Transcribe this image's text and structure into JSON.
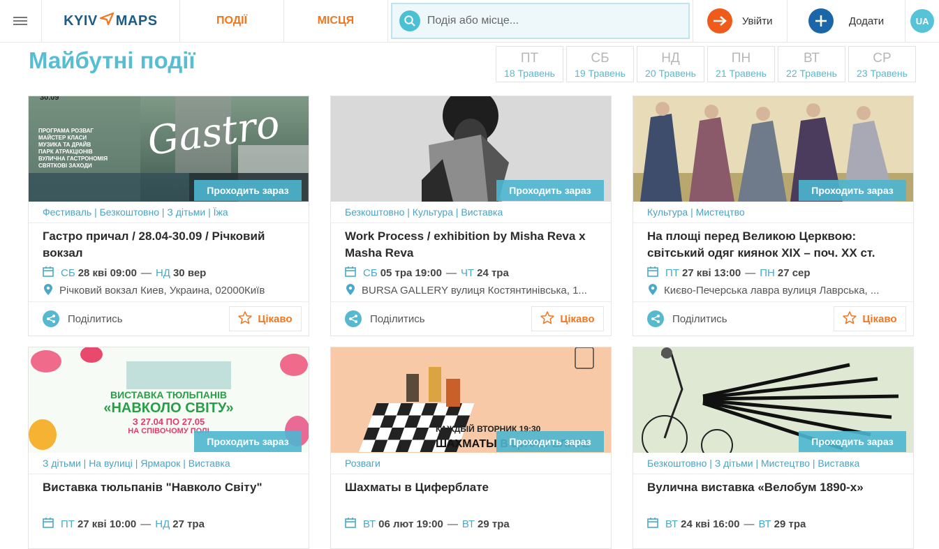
{
  "header": {
    "logo_left": "KYIV",
    "logo_right": "MAPS",
    "nav_events": "ПОДІЇ",
    "nav_places": "МІСЦЯ",
    "search_placeholder": "Подія або місце...",
    "login_label": "Увійти",
    "add_label": "Додати",
    "lang": "UA"
  },
  "page_title": "Майбутні події",
  "days": [
    {
      "name": "ПТ",
      "date": "18 Травень"
    },
    {
      "name": "СБ",
      "date": "19 Травень"
    },
    {
      "name": "НД",
      "date": "20 Травень"
    },
    {
      "name": "ПН",
      "date": "21 Травень"
    },
    {
      "name": "ВТ",
      "date": "22 Травень"
    },
    {
      "name": "СР",
      "date": "23 Травень"
    }
  ],
  "badge_label": "Проходить зараз",
  "share_label": "Поділитись",
  "fav_label": "Цікаво",
  "cards": [
    {
      "categories": "Фестиваль | Безкоштовно | З дітьми | Їжа",
      "title": "Гастро причал / 28.04-30.09 / Річковий вокзал",
      "start_wd": "СБ",
      "start": "28 кві 09:00",
      "end_wd": "НД",
      "end": "30 вер",
      "place": "Річковий вокзал Киев, Украина, 02000Київ",
      "image_text": [
        "ПРОГРАМА РОЗВАГ",
        "МАЙСТЕР КЛАСИ",
        "МУЗИКА ТА ДРАЙВ",
        "ПАРК АТРАКЦІОНІВ",
        "ВУЛИЧНА ГАСТРОНОМІЯ",
        "СВЯТКОВІ ЗАХОДИ"
      ],
      "image_script": "Gastro",
      "image_date": "30.09"
    },
    {
      "categories": "Безкоштовно | Культура | Виставка",
      "title": "Work Process / exhibition by Misha Reva x Masha Reva",
      "start_wd": "СБ",
      "start": "05 тра 19:00",
      "end_wd": "ЧТ",
      "end": "24 тра",
      "place": "BURSA GALLERY вулиця Костянтинівська, 1..."
    },
    {
      "categories": "Культура | Мистецтво",
      "title": "На площі перед Великою Церквою: світський одяг киянок XIX – поч. XX ст.",
      "start_wd": "ПТ",
      "start": "27 кві 13:00",
      "end_wd": "ПН",
      "end": "27 сер",
      "place": "Києво-Печерська лавра вулиця Лаврська, ..."
    },
    {
      "categories": "З дітьми | На вулиці | Ярмарок | Виставка",
      "title": "Виставка тюльпанів \"Навколо Світу\"",
      "start_wd": "ПТ",
      "start": "27 кві 10:00",
      "end_wd": "НД",
      "end": "27 тра",
      "image_text": [
        "ВИСТАВКА ТЮЛЬПАНІВ",
        "«НАВКОЛО СВІТУ»",
        "З 27.04 ПО 27.05",
        "НА СПІВОЧОМУ ПОЛІ"
      ]
    },
    {
      "categories": "Розваги",
      "title": "Шахматы в Циферблате",
      "start_wd": "ВТ",
      "start": "06 лют 19:00",
      "end_wd": "ВТ",
      "end": "29 тра",
      "image_text": [
        "КАЖДЫЙ ВТОРНИК 19:30",
        "ШАХМАТЫ В ЦИФЕРБЛАТЕ"
      ]
    },
    {
      "categories": "Безкоштовно | З дітьми | Мистецтво | Виставка",
      "title": "Вулична виставка «Велобум 1890-х»",
      "start_wd": "ВТ",
      "start": "24 кві 16:00",
      "end_wd": "ВТ",
      "end": "29 тра"
    }
  ]
}
